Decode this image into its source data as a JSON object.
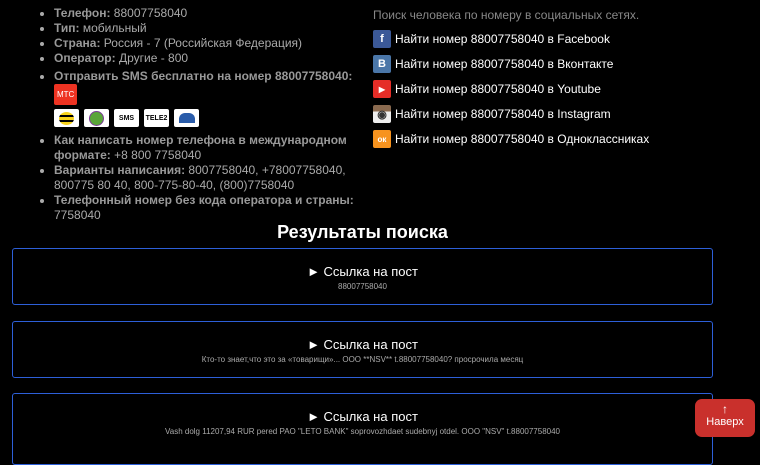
{
  "info": [
    {
      "label": "Телефон:",
      "value": " 88007758040"
    },
    {
      "label": "Тип:",
      "value": " мобильный"
    },
    {
      "label": "Страна:",
      "value": " Россия - 7 (Российская Федерация)"
    },
    {
      "label": "Оператор:",
      "value": " Другие - 800"
    }
  ],
  "sms": {
    "label": "Отправить SMS бесплатно на номер 88007758040:",
    "mts": "МТС",
    "operators": [
      "Билайн",
      "МегаФон",
      "SMS",
      "TELE2",
      "Ростелеком"
    ]
  },
  "info2": [
    {
      "label": "Как написать номер телефона в международном формате:",
      "value": " +8 800 7758040"
    },
    {
      "label": "Варианты написания:",
      "value": " 8007758040, +78007758040, 800775 80 40, 800-775-80-40, (800)7758040"
    },
    {
      "label": "Телефонный номер без кода оператора и страны:",
      "value": " 7758040"
    }
  ],
  "social": {
    "intro": "Поиск человека по номеру в социальных сетях.",
    "links": [
      {
        "label": "Найти номер 88007758040 в Facebook",
        "icon": "f",
        "color": "#3b5998"
      },
      {
        "label": "Найти номер 88007758040 в Вконтакте",
        "icon": "B",
        "color": "#4a76a8"
      },
      {
        "label": "Найти номер 88007758040 в Youtube",
        "icon": "▶",
        "color": "#e52d27"
      },
      {
        "label": "Найти номер 88007758040 в Instagram",
        "icon": "◉",
        "color": "#8a6a4f"
      },
      {
        "label": "Найти номер 88007758040 в Одноклассниках",
        "icon": "ок",
        "color": "#f7931e"
      }
    ]
  },
  "results": {
    "title": "Результаты поиска",
    "items": [
      {
        "title": "► Ссылка на пост",
        "snippet": "88007758040"
      },
      {
        "title": "► Ссылка на пост",
        "snippet": "Кто-то знает,что это за «товарищи»... ООО **NSV** t.88007758040? просрочила месяц"
      },
      {
        "title": "► Ссылка на пост",
        "snippet": "Vash dolg 11207,94 RUR pered PAO \"LETO BANK\" soprovozhdaet sudebnyj otdel. OOO \"NSV\" t.88007758040"
      }
    ]
  },
  "top_button": {
    "arrow": "🡅",
    "label": "Наверх"
  }
}
